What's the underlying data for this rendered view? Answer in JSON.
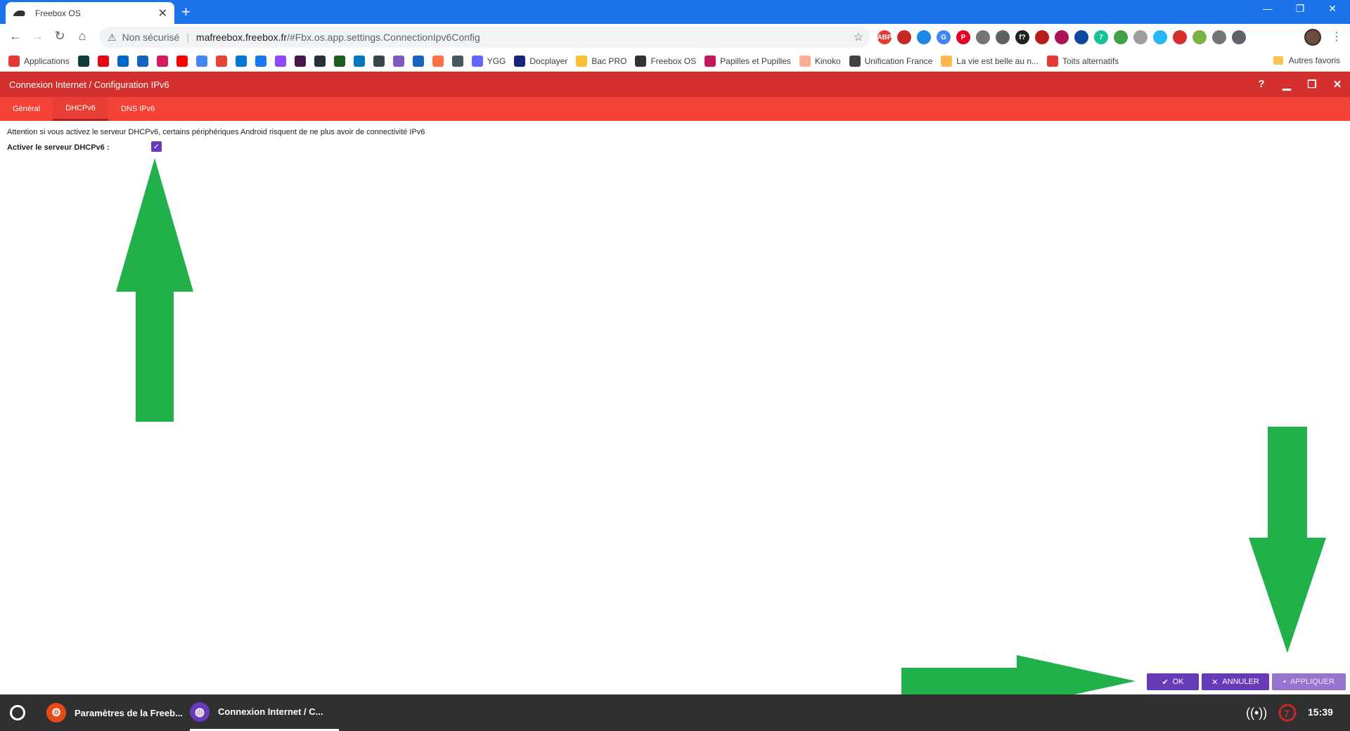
{
  "browser": {
    "tab_title": "Freebox OS",
    "tab_close": "✕",
    "new_tab": "+",
    "window_controls": {
      "minimize": "—",
      "restore": "❐",
      "close": "✕"
    },
    "address": {
      "security_label": "Non sécurisé",
      "url_host": "mafreebox.freebox.fr",
      "url_path": "/#Fbx.os.app.settings.ConnectionIpv6Config"
    }
  },
  "extensions": [
    {
      "icon": "abp-icon",
      "text": "ABP",
      "color": "#e53935"
    },
    {
      "icon": "ublock-icon",
      "text": "",
      "color": "#c62828"
    },
    {
      "icon": "extension-blue-icon",
      "text": "",
      "color": "#1e88e5"
    },
    {
      "icon": "translate-icon",
      "text": "G",
      "color": "#4285f4"
    },
    {
      "icon": "pinterest-icon",
      "text": "P",
      "color": "#e60023"
    },
    {
      "icon": "eye-icon",
      "text": "",
      "color": "#757575"
    },
    {
      "icon": "bird-icon",
      "text": "",
      "color": "#616161"
    },
    {
      "icon": "fquestion-icon",
      "text": "f?",
      "color": "#212121"
    },
    {
      "icon": "shield-red-icon",
      "text": "",
      "color": "#b71c1c"
    },
    {
      "icon": "folder-red-icon",
      "text": "",
      "color": "#ad1457"
    },
    {
      "icon": "bars-icon",
      "text": "",
      "color": "#0d47a1"
    },
    {
      "icon": "grammarly-icon",
      "text": "7",
      "color": "#15c39a"
    },
    {
      "icon": "globe-green-icon",
      "text": "",
      "color": "#43a047"
    },
    {
      "icon": "link-icon",
      "text": "",
      "color": "#9e9e9e"
    },
    {
      "icon": "feather-icon",
      "text": "",
      "color": "#29b6f6"
    },
    {
      "icon": "invader-icon",
      "text": "",
      "color": "#d32f2f"
    },
    {
      "icon": "shield-green-icon",
      "text": "",
      "color": "#7cb342"
    },
    {
      "icon": "people-icon",
      "text": "",
      "color": "#757575"
    },
    {
      "icon": "puzzle-icon",
      "text": "",
      "color": "#5f6368"
    }
  ],
  "bookmarks": [
    {
      "label": "Applications",
      "color": "#e53935"
    },
    {
      "label": "",
      "color": "#0f3d3e"
    },
    {
      "label": "",
      "color": "#e50914"
    },
    {
      "label": "",
      "color": "#0066cc"
    },
    {
      "label": "",
      "color": "#1565c0"
    },
    {
      "label": "",
      "color": "#d81b60"
    },
    {
      "label": "",
      "color": "#ff0000"
    },
    {
      "label": "",
      "color": "#4285f4"
    },
    {
      "label": "",
      "color": "#ea4335"
    },
    {
      "label": "",
      "color": "#0078d4"
    },
    {
      "label": "",
      "color": "#1877f2"
    },
    {
      "label": "",
      "color": "#9146ff"
    },
    {
      "label": "",
      "color": "#4a154b"
    },
    {
      "label": "",
      "color": "#263238"
    },
    {
      "label": "",
      "color": "#1b5e20"
    },
    {
      "label": "",
      "color": "#0277bd"
    },
    {
      "label": "",
      "color": "#37474f"
    },
    {
      "label": "",
      "color": "#7e57c2"
    },
    {
      "label": "",
      "color": "#1565c0"
    },
    {
      "label": "",
      "color": "#ff7043"
    },
    {
      "label": "",
      "color": "#455a64"
    },
    {
      "label": "YGG",
      "color": "#6364ff"
    },
    {
      "label": "Docplayer",
      "color": "#1a237e"
    },
    {
      "label": "Bac PRO",
      "color": "#fbc02d"
    },
    {
      "label": "Freebox OS",
      "color": "#333333"
    },
    {
      "label": "Papilles et Pupilles",
      "color": "#c2185b"
    },
    {
      "label": "Kinoko",
      "color": "#ffab91"
    },
    {
      "label": "Unification France",
      "color": "#424242"
    },
    {
      "label": "La vie est belle au n...",
      "color": "#ffb74d"
    },
    {
      "label": "Toits alternatifs",
      "color": "#e53935"
    }
  ],
  "other_bookmarks": "Autres favoris",
  "app_window": {
    "title": "Connexion Internet / Configuration IPv6",
    "controls": {
      "help": "?",
      "minimize": "▁",
      "maximize": "❐",
      "close": "✕"
    },
    "tabs": [
      {
        "label": "Général",
        "active": false
      },
      {
        "label": "DHCPv6",
        "active": true
      },
      {
        "label": "DNS IPv6",
        "active": false
      }
    ],
    "warning": "Attention si vous activez le serveur DHCPv6, certains périphériques Android risquent de ne plus avoir de connectivité IPv6",
    "dhcp_label": "Activer le serveur DHCPv6 :",
    "dhcp_checked": true,
    "check_mark": "✓",
    "buttons": {
      "ok": "OK",
      "cancel": "ANNULER",
      "apply": "APPLIQUER"
    }
  },
  "taskbar": {
    "items": [
      {
        "label": "Paramètres de la Freeb...",
        "color": "#e64a19"
      },
      {
        "label": "Connexion Internet / C...",
        "color": "#673ab7"
      }
    ],
    "time": "15:39"
  },
  "colors": {
    "chrome_blue": "#1a73e8",
    "header_red": "#d32f2f",
    "tabs_red": "#f44336",
    "accent_purple": "#673ab7",
    "arrow_green": "#22b04b",
    "taskbar": "#303030"
  }
}
